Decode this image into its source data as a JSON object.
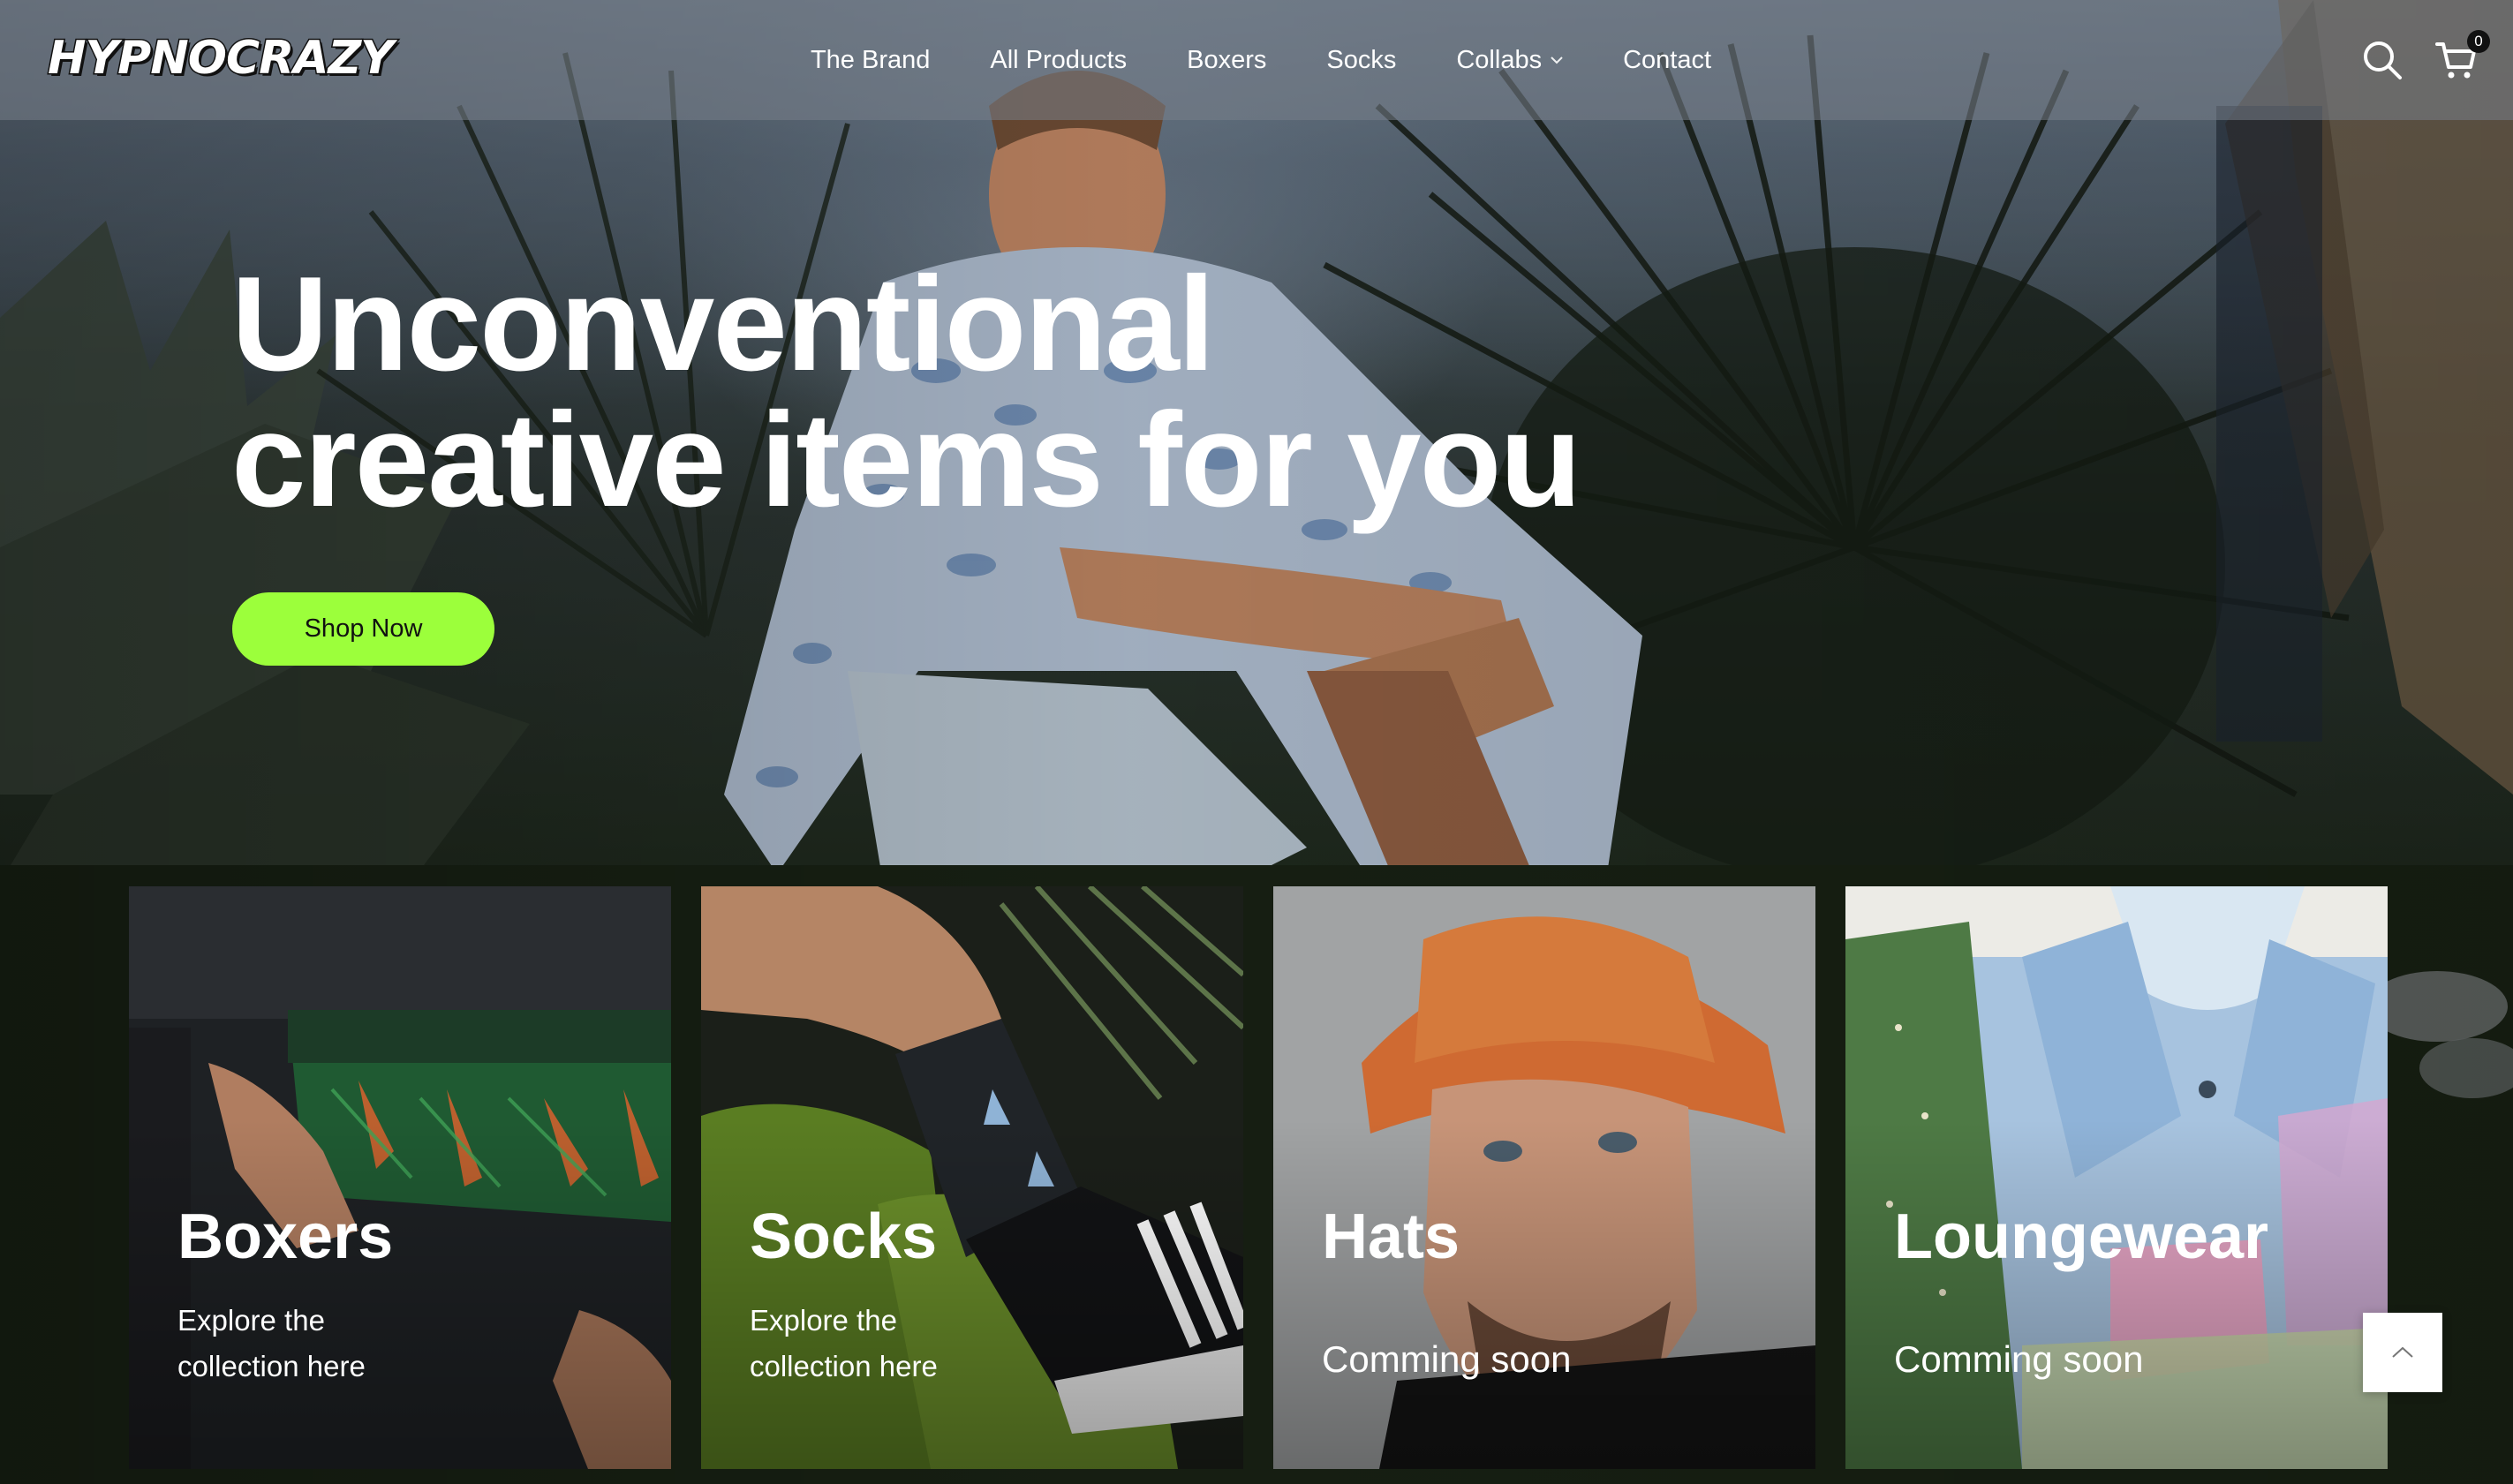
{
  "brand": {
    "logo_text": "HYPNOCRAZY"
  },
  "nav": {
    "items": [
      {
        "label": "The Brand"
      },
      {
        "label": "All Products"
      },
      {
        "label": "Boxers"
      },
      {
        "label": "Socks"
      },
      {
        "label": "Collabs",
        "has_dropdown": true
      },
      {
        "label": "Contact"
      }
    ]
  },
  "header": {
    "search_icon": "search-icon",
    "cart_icon": "cart-icon",
    "cart_count": "0"
  },
  "hero": {
    "title_line1": "Unconventional",
    "title_line2": "creative items for you",
    "cta_label": "Shop Now",
    "cta_color": "#9cff3b"
  },
  "categories": [
    {
      "title": "Boxers",
      "subtitle": "Explore the collection here"
    },
    {
      "title": "Socks",
      "subtitle": "Explore the collection here"
    },
    {
      "title": "Hats",
      "subtitle": "Comming soon"
    },
    {
      "title": "Loungewear",
      "subtitle": "Comming soon"
    }
  ],
  "back_to_top_icon": "chevron-up-icon"
}
